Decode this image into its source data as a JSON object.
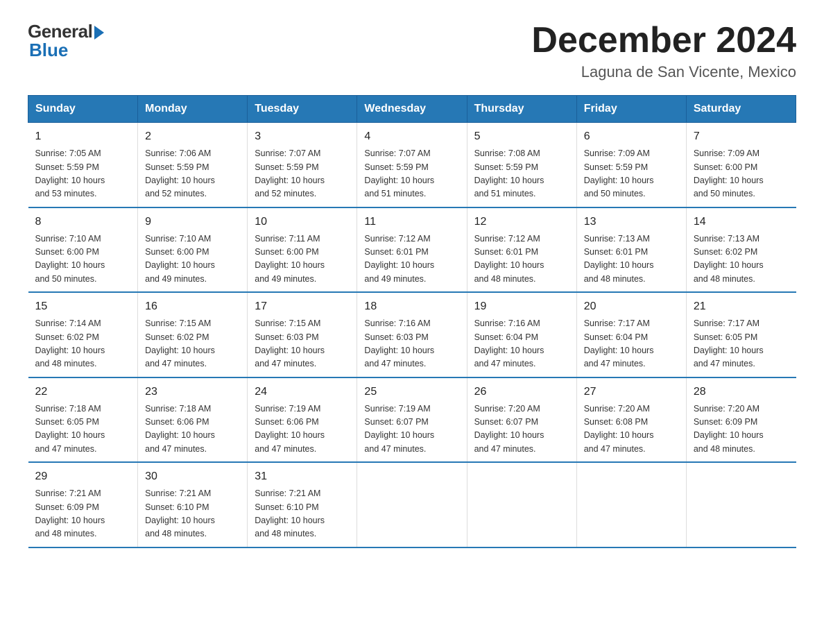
{
  "header": {
    "logo_general": "General",
    "logo_blue": "Blue",
    "month_title": "December 2024",
    "subtitle": "Laguna de San Vicente, Mexico"
  },
  "weekdays": [
    "Sunday",
    "Monday",
    "Tuesday",
    "Wednesday",
    "Thursday",
    "Friday",
    "Saturday"
  ],
  "weeks": [
    [
      {
        "day": "1",
        "info": "Sunrise: 7:05 AM\nSunset: 5:59 PM\nDaylight: 10 hours\nand 53 minutes."
      },
      {
        "day": "2",
        "info": "Sunrise: 7:06 AM\nSunset: 5:59 PM\nDaylight: 10 hours\nand 52 minutes."
      },
      {
        "day": "3",
        "info": "Sunrise: 7:07 AM\nSunset: 5:59 PM\nDaylight: 10 hours\nand 52 minutes."
      },
      {
        "day": "4",
        "info": "Sunrise: 7:07 AM\nSunset: 5:59 PM\nDaylight: 10 hours\nand 51 minutes."
      },
      {
        "day": "5",
        "info": "Sunrise: 7:08 AM\nSunset: 5:59 PM\nDaylight: 10 hours\nand 51 minutes."
      },
      {
        "day": "6",
        "info": "Sunrise: 7:09 AM\nSunset: 5:59 PM\nDaylight: 10 hours\nand 50 minutes."
      },
      {
        "day": "7",
        "info": "Sunrise: 7:09 AM\nSunset: 6:00 PM\nDaylight: 10 hours\nand 50 minutes."
      }
    ],
    [
      {
        "day": "8",
        "info": "Sunrise: 7:10 AM\nSunset: 6:00 PM\nDaylight: 10 hours\nand 50 minutes."
      },
      {
        "day": "9",
        "info": "Sunrise: 7:10 AM\nSunset: 6:00 PM\nDaylight: 10 hours\nand 49 minutes."
      },
      {
        "day": "10",
        "info": "Sunrise: 7:11 AM\nSunset: 6:00 PM\nDaylight: 10 hours\nand 49 minutes."
      },
      {
        "day": "11",
        "info": "Sunrise: 7:12 AM\nSunset: 6:01 PM\nDaylight: 10 hours\nand 49 minutes."
      },
      {
        "day": "12",
        "info": "Sunrise: 7:12 AM\nSunset: 6:01 PM\nDaylight: 10 hours\nand 48 minutes."
      },
      {
        "day": "13",
        "info": "Sunrise: 7:13 AM\nSunset: 6:01 PM\nDaylight: 10 hours\nand 48 minutes."
      },
      {
        "day": "14",
        "info": "Sunrise: 7:13 AM\nSunset: 6:02 PM\nDaylight: 10 hours\nand 48 minutes."
      }
    ],
    [
      {
        "day": "15",
        "info": "Sunrise: 7:14 AM\nSunset: 6:02 PM\nDaylight: 10 hours\nand 48 minutes."
      },
      {
        "day": "16",
        "info": "Sunrise: 7:15 AM\nSunset: 6:02 PM\nDaylight: 10 hours\nand 47 minutes."
      },
      {
        "day": "17",
        "info": "Sunrise: 7:15 AM\nSunset: 6:03 PM\nDaylight: 10 hours\nand 47 minutes."
      },
      {
        "day": "18",
        "info": "Sunrise: 7:16 AM\nSunset: 6:03 PM\nDaylight: 10 hours\nand 47 minutes."
      },
      {
        "day": "19",
        "info": "Sunrise: 7:16 AM\nSunset: 6:04 PM\nDaylight: 10 hours\nand 47 minutes."
      },
      {
        "day": "20",
        "info": "Sunrise: 7:17 AM\nSunset: 6:04 PM\nDaylight: 10 hours\nand 47 minutes."
      },
      {
        "day": "21",
        "info": "Sunrise: 7:17 AM\nSunset: 6:05 PM\nDaylight: 10 hours\nand 47 minutes."
      }
    ],
    [
      {
        "day": "22",
        "info": "Sunrise: 7:18 AM\nSunset: 6:05 PM\nDaylight: 10 hours\nand 47 minutes."
      },
      {
        "day": "23",
        "info": "Sunrise: 7:18 AM\nSunset: 6:06 PM\nDaylight: 10 hours\nand 47 minutes."
      },
      {
        "day": "24",
        "info": "Sunrise: 7:19 AM\nSunset: 6:06 PM\nDaylight: 10 hours\nand 47 minutes."
      },
      {
        "day": "25",
        "info": "Sunrise: 7:19 AM\nSunset: 6:07 PM\nDaylight: 10 hours\nand 47 minutes."
      },
      {
        "day": "26",
        "info": "Sunrise: 7:20 AM\nSunset: 6:07 PM\nDaylight: 10 hours\nand 47 minutes."
      },
      {
        "day": "27",
        "info": "Sunrise: 7:20 AM\nSunset: 6:08 PM\nDaylight: 10 hours\nand 47 minutes."
      },
      {
        "day": "28",
        "info": "Sunrise: 7:20 AM\nSunset: 6:09 PM\nDaylight: 10 hours\nand 48 minutes."
      }
    ],
    [
      {
        "day": "29",
        "info": "Sunrise: 7:21 AM\nSunset: 6:09 PM\nDaylight: 10 hours\nand 48 minutes."
      },
      {
        "day": "30",
        "info": "Sunrise: 7:21 AM\nSunset: 6:10 PM\nDaylight: 10 hours\nand 48 minutes."
      },
      {
        "day": "31",
        "info": "Sunrise: 7:21 AM\nSunset: 6:10 PM\nDaylight: 10 hours\nand 48 minutes."
      },
      {
        "day": "",
        "info": ""
      },
      {
        "day": "",
        "info": ""
      },
      {
        "day": "",
        "info": ""
      },
      {
        "day": "",
        "info": ""
      }
    ]
  ]
}
